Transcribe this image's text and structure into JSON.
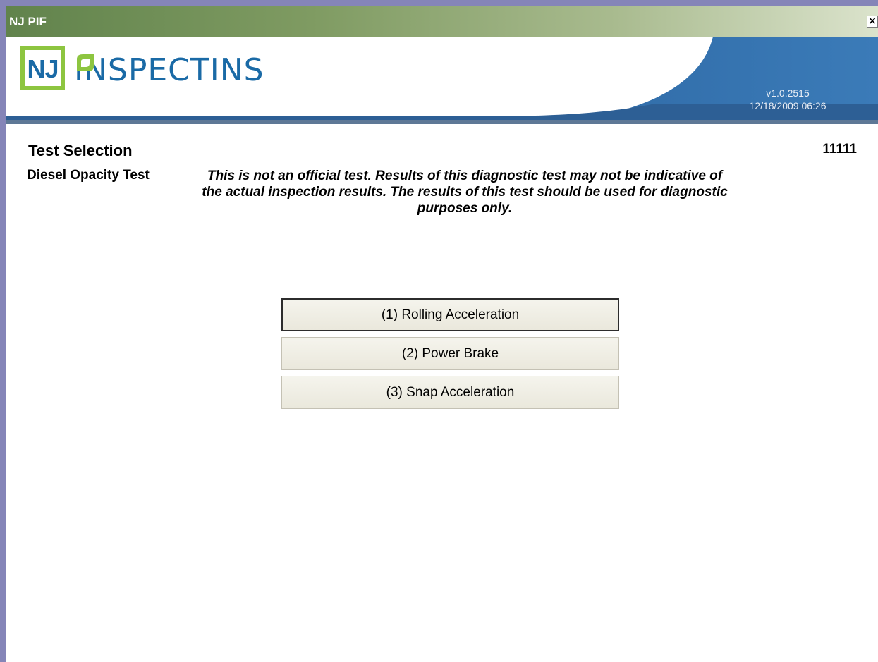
{
  "window": {
    "title": "NJ PIF",
    "close_symbol": "×"
  },
  "header": {
    "logo_mark": "NJ",
    "logo_word": "INSPECTI",
    "logo_word_tail": "NS",
    "version": "v1.0.2515",
    "datetime": "12/18/2009 06:26"
  },
  "page": {
    "title": "Test Selection",
    "station_id": "11111",
    "test_type": "Diesel Opacity Test",
    "disclaimer": "This is not an official test. Results of this diagnostic test may not be indicative of the actual inspection results. The results of this test should be used for diagnostic purposes only."
  },
  "options": [
    {
      "label": "(1) Rolling Acceleration",
      "selected": true
    },
    {
      "label": "(2) Power Brake",
      "selected": false
    },
    {
      "label": "(3) Snap Acceleration",
      "selected": false
    }
  ],
  "colors": {
    "brand_blue": "#1a6aa6",
    "brand_green": "#8dc540",
    "titlebar_green": "#61834c",
    "window_border": "#8585b8"
  }
}
